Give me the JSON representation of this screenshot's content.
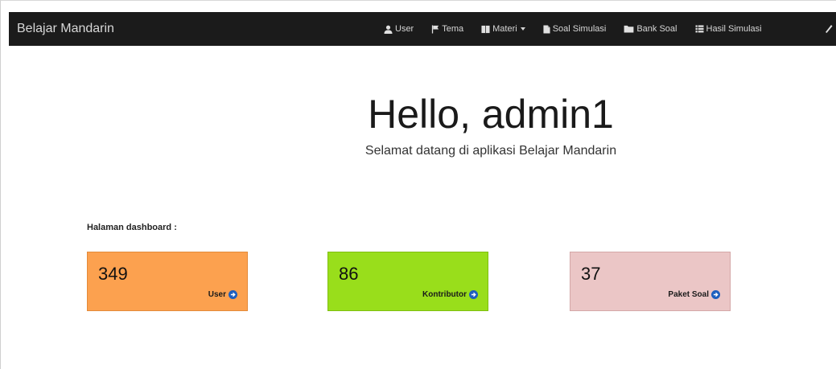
{
  "app": {
    "brand": "Belajar Mandarin"
  },
  "nav": {
    "items": [
      {
        "label": "User",
        "icon": "user-icon"
      },
      {
        "label": "Tema",
        "icon": "flag-icon"
      },
      {
        "label": "Materi",
        "icon": "book-icon",
        "dropdown": true
      },
      {
        "label": "Soal Simulasi",
        "icon": "file-icon"
      },
      {
        "label": "Bank Soal",
        "icon": "folder-icon"
      },
      {
        "label": "Hasil Simulasi",
        "icon": "list-icon"
      }
    ],
    "edge_icon": "pencil-icon"
  },
  "hero": {
    "title": "Hello, admin1",
    "subtitle": "Selamat datang di aplikasi Belajar Mandarin"
  },
  "dashboard": {
    "label": "Halaman dashboard :",
    "cards": [
      {
        "value": "349",
        "link": "User",
        "color": "#fca14f",
        "border": "#e38a3a"
      },
      {
        "value": "86",
        "link": "Kontributor",
        "color": "#99de1b",
        "border": "#7fbf10"
      },
      {
        "value": "37",
        "link": "Paket Soal",
        "color": "#ebc6c6",
        "border": "#d4a7a7"
      }
    ],
    "link_icon": "circle-arrow-right-icon"
  },
  "colors": {
    "navbar": "#1b1b1b",
    "accent": "#1e5fbf"
  }
}
